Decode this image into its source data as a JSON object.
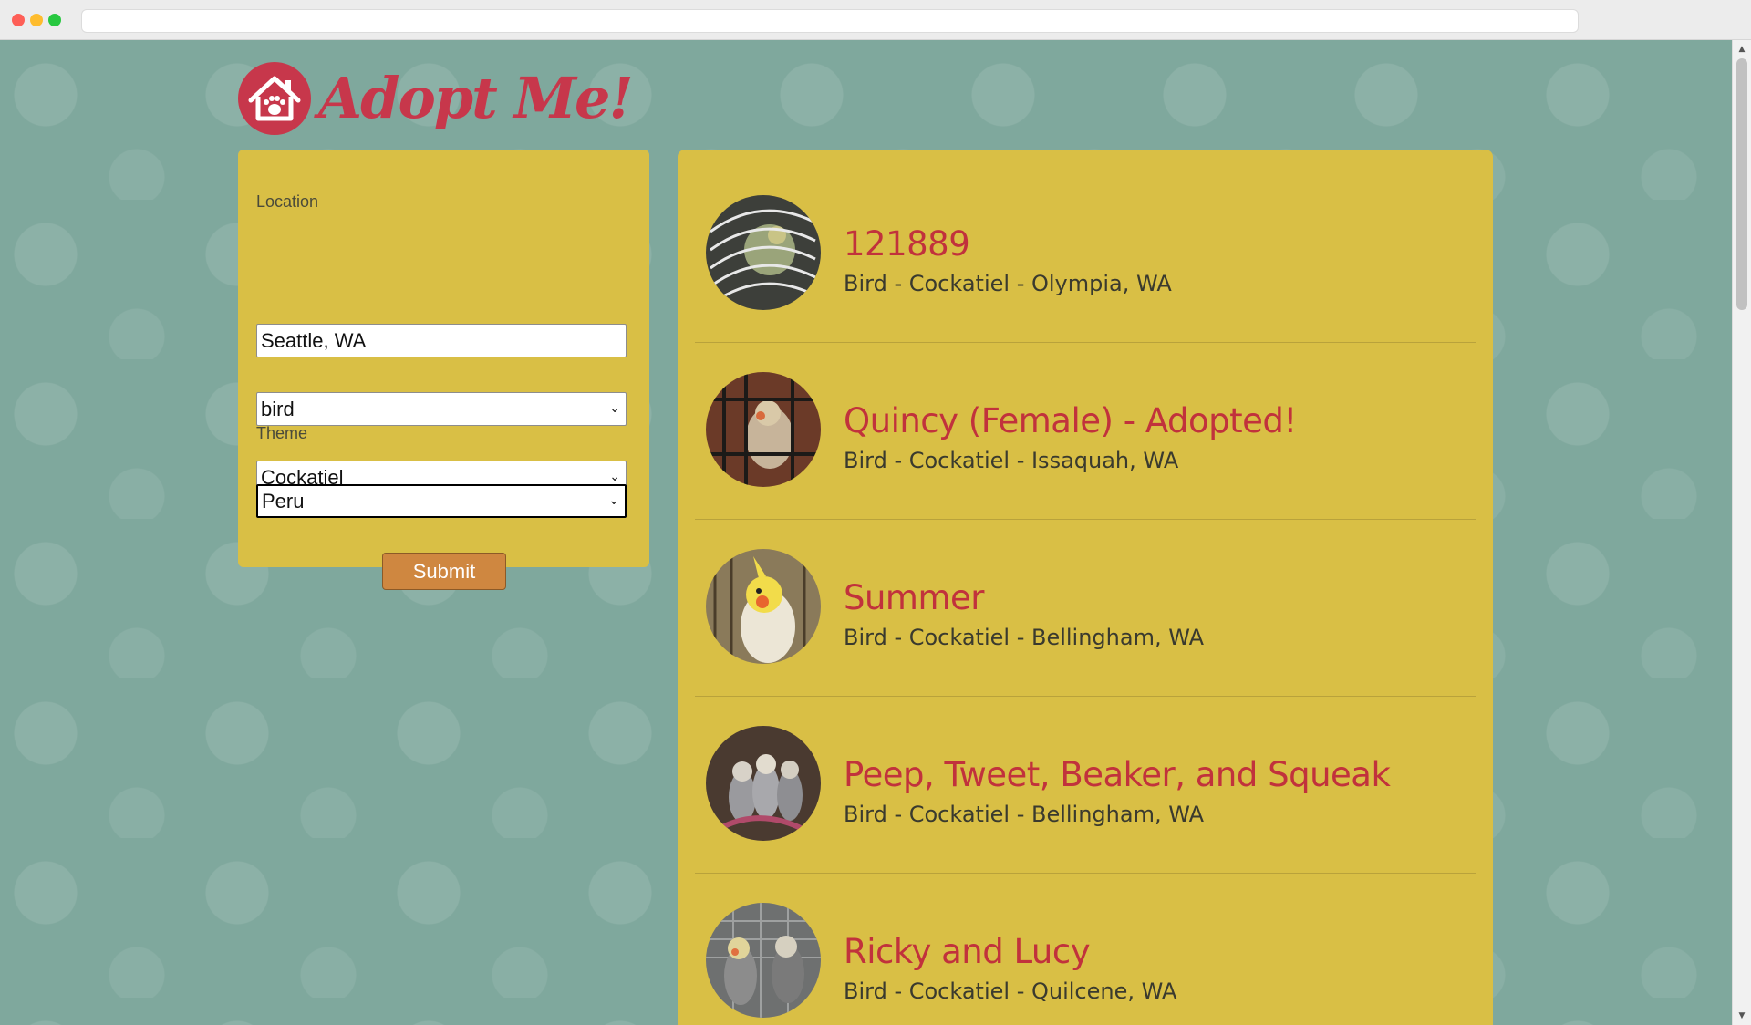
{
  "app": {
    "logo_text": "Adopt Me!",
    "logo_icon": "house-paw-icon"
  },
  "search": {
    "location_label": "Location",
    "location_value": "Seattle, WA",
    "animal_value": "bird",
    "breed_value": "Cockatiel",
    "theme_label": "Theme",
    "theme_value": "Peru",
    "submit_label": "Submit"
  },
  "results": [
    {
      "name": "121889",
      "description": "Bird - Cockatiel - Olympia, WA"
    },
    {
      "name": "Quincy (Female) - Adopted!",
      "description": "Bird - Cockatiel - Issaquah, WA"
    },
    {
      "name": "Summer",
      "description": "Bird - Cockatiel - Bellingham, WA"
    },
    {
      "name": "Peep, Tweet, Beaker, and Squeak",
      "description": "Bird - Cockatiel - Bellingham, WA"
    },
    {
      "name": "Ricky and Lucy",
      "description": "Bird - Cockatiel - Quilcene, WA"
    }
  ],
  "colors": {
    "background": "#7fa89d",
    "panel": "#d9bf45",
    "accent": "#c1323c",
    "button": "#cf8740"
  }
}
